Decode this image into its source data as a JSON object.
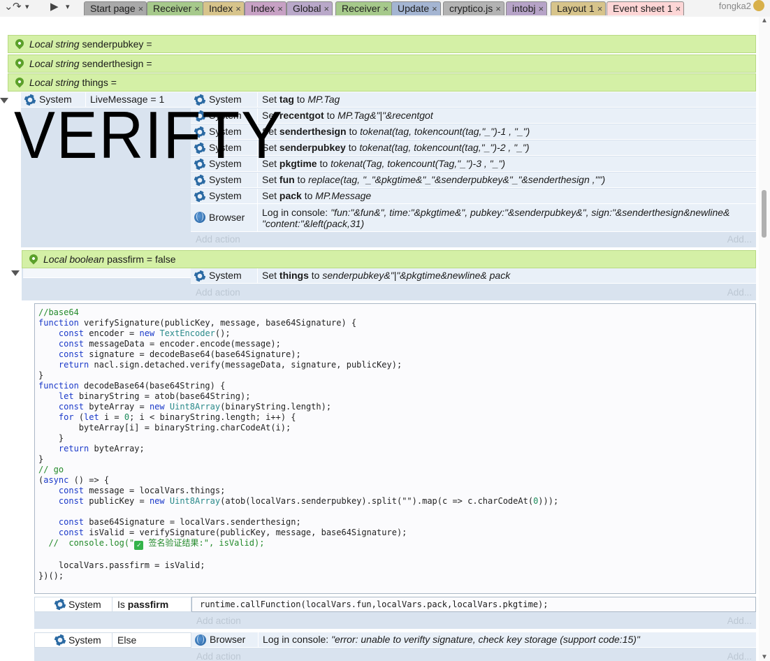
{
  "toolbar": {
    "redo_icon": "redo-icon",
    "play_icon": "play-icon",
    "dropdown_icon": "chevron-down-icon"
  },
  "tabs": [
    {
      "label": "Start page",
      "color": "#a9a9a9"
    },
    {
      "label": "Receiver",
      "color": "#a6c98b"
    },
    {
      "label": "Index",
      "color": "#d7c48b"
    },
    {
      "label": "Index",
      "color": "#c7a1c4"
    },
    {
      "label": "Global",
      "color": "#b9a8c9"
    },
    {
      "label": "Receiver",
      "color": "#a6c98b"
    },
    {
      "label": "Update",
      "color": "#a4b5d2"
    },
    {
      "label": "cryptico.js",
      "color": "#b3b3b3"
    },
    {
      "label": "intobj",
      "color": "#b6a3c7"
    },
    {
      "label": "Layout 1",
      "color": "#d7c48b"
    },
    {
      "label": "Event sheet 1",
      "color": "#fdd6d6"
    }
  ],
  "user": {
    "name": "fongka2"
  },
  "local_vars": [
    {
      "kind": "Local string",
      "name": "senderpubkey",
      "suffix": "="
    },
    {
      "kind": "Local string",
      "name": "senderthesign",
      "suffix": "="
    },
    {
      "kind": "Local string",
      "name": "things",
      "suffix": "="
    }
  ],
  "overlay_title": "VERIFTY",
  "event1": {
    "condition": {
      "object": "System",
      "text": "LiveMessage = 1"
    },
    "actions": [
      {
        "object": "System",
        "icon": "gear-icon",
        "pre": "Set ",
        "bold": "tag",
        "mid": " to ",
        "expr": "MP.Tag"
      },
      {
        "object": "System",
        "icon": "gear-icon",
        "pre": "Set ",
        "bold": "recentgot",
        "mid": " to ",
        "expr": "MP.Tag&\"|\"&recentgot"
      },
      {
        "object": "System",
        "icon": "gear-icon",
        "pre": "Set ",
        "bold": "senderthesign",
        "mid": " to ",
        "expr": "tokenat(tag, tokencount(tag,\"_\")-1 , \"_\")"
      },
      {
        "object": "System",
        "icon": "gear-icon",
        "pre": "Set ",
        "bold": "senderpubkey",
        "mid": " to ",
        "expr": "tokenat(tag, tokencount(tag,\"_\")-2 , \"_\")"
      },
      {
        "object": "System",
        "icon": "gear-icon",
        "pre": "Set ",
        "bold": "pkgtime",
        "mid": " to ",
        "expr": "tokenat(Tag, tokencount(Tag,\"_\")-3 , \"_\")"
      },
      {
        "object": "System",
        "icon": "gear-icon",
        "pre": "Set ",
        "bold": "fun",
        "mid": " to ",
        "expr": "replace(tag, \"_\"&pkgtime&\"_\"&senderpubkey&\"_\"&senderthesign ,\"\")"
      },
      {
        "object": "System",
        "icon": "gear-icon",
        "pre": "Set ",
        "bold": "pack",
        "mid": " to ",
        "expr": "MP.Message"
      }
    ],
    "log_action": {
      "object": "Browser",
      "pre": "Log in console: ",
      "line1": "\"fun:\"&fun&\", time:\"&pkgtime&\", pubkey:\"&senderpubkey&\", sign:\"&senderthesign&newline&",
      "line2": "\"content:\"&left(pack,31)"
    },
    "add_action": "Add action",
    "add_more": "Add..."
  },
  "local_bool": {
    "kind": "Local boolean",
    "name": "passfirm",
    "suffix": "= false"
  },
  "event2": {
    "action": {
      "object": "System",
      "pre": "Set ",
      "bold": "things",
      "mid": " to ",
      "expr": "senderpubkey&\"|\"&pkgtime&newline& pack"
    },
    "add_action": "Add action",
    "add_more": "Add..."
  },
  "code": {
    "lines": [
      "//base64",
      "function verifySignature(publicKey, message, base64Signature) {",
      "    const encoder = new TextEncoder();",
      "    const messageData = encoder.encode(message);",
      "    const signature = decodeBase64(base64Signature);",
      "    return nacl.sign.detached.verify(messageData, signature, publicKey);",
      "}",
      "function decodeBase64(base64String) {",
      "    let binaryString = atob(base64String);",
      "    const byteArray = new Uint8Array(binaryString.length);",
      "    for (let i = 0; i < binaryString.length; i++) {",
      "        byteArray[i] = binaryString.charCodeAt(i);",
      "    }",
      "    return byteArray;",
      "}",
      "// go",
      "(async () => {",
      "    const message = localVars.things;",
      "    const publicKey = new Uint8Array(atob(localVars.senderpubkey).split(\"\").map(c => c.charCodeAt(0)));",
      "",
      "    const base64Signature = localVars.senderthesign;",
      "    const isValid = verifySignature(publicKey, message, base64Signature);",
      "  //  console.log(\"✅ 签名验证结果:\", isValid);",
      "",
      "    localVars.passfirm = isValid;",
      "})();"
    ]
  },
  "event3": {
    "condition": {
      "object": "System",
      "pre": "Is ",
      "bold": "passfirm"
    },
    "action_code": "runtime.callFunction(localVars.fun,localVars.pack,localVars.pkgtime);",
    "add_action": "Add action",
    "add_more": "Add..."
  },
  "event4": {
    "condition": {
      "object": "System",
      "text": "Else"
    },
    "action": {
      "object": "Browser",
      "pre": "Log in console: ",
      "expr": "\"error: unable to verifty signature, check key storage (support code:15)\""
    },
    "add_action": "Add action",
    "add_more": "Add..."
  },
  "colors": {
    "local_var_bg": "#d4f0a6",
    "event_bg": "#d9e3ef",
    "row_bg": "#e9f0f8",
    "pin": "#5ba02a",
    "gear": "#2b6aa3"
  }
}
